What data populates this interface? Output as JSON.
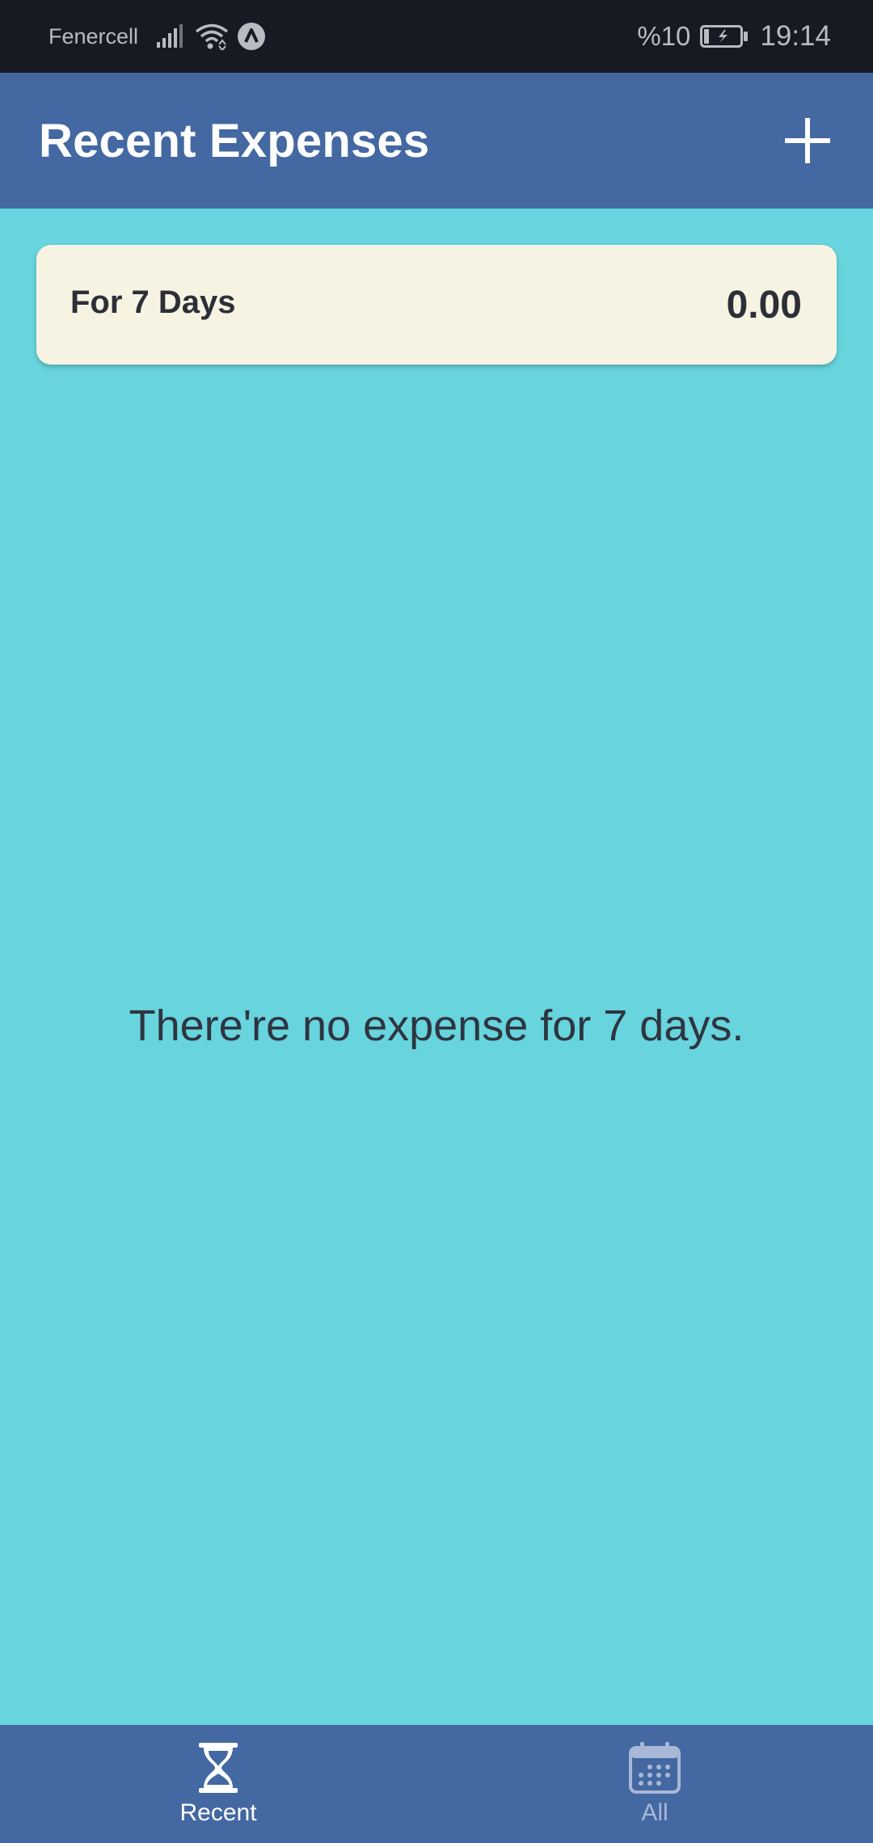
{
  "status_bar": {
    "carrier": "Fenercell",
    "battery_percent": "%10",
    "time": "19:14",
    "icons": [
      "signal-icon",
      "wifi-icon",
      "vpn-icon",
      "battery-charging-icon"
    ]
  },
  "app_bar": {
    "title": "Recent Expenses",
    "add_icon": "plus-icon"
  },
  "summary": {
    "label": "For 7 Days",
    "amount": "0.00"
  },
  "empty_state": {
    "message": "There're no expense for 7 days."
  },
  "bottom_nav": {
    "tabs": [
      {
        "label": "Recent",
        "icon": "hourglass-icon",
        "active": true
      },
      {
        "label": "All",
        "icon": "calendar-icon",
        "active": false
      }
    ]
  },
  "colors": {
    "background": "#68d4dd",
    "primary": "#4368a2",
    "card": "#f7f3e2",
    "status_bar": "#171a22"
  }
}
